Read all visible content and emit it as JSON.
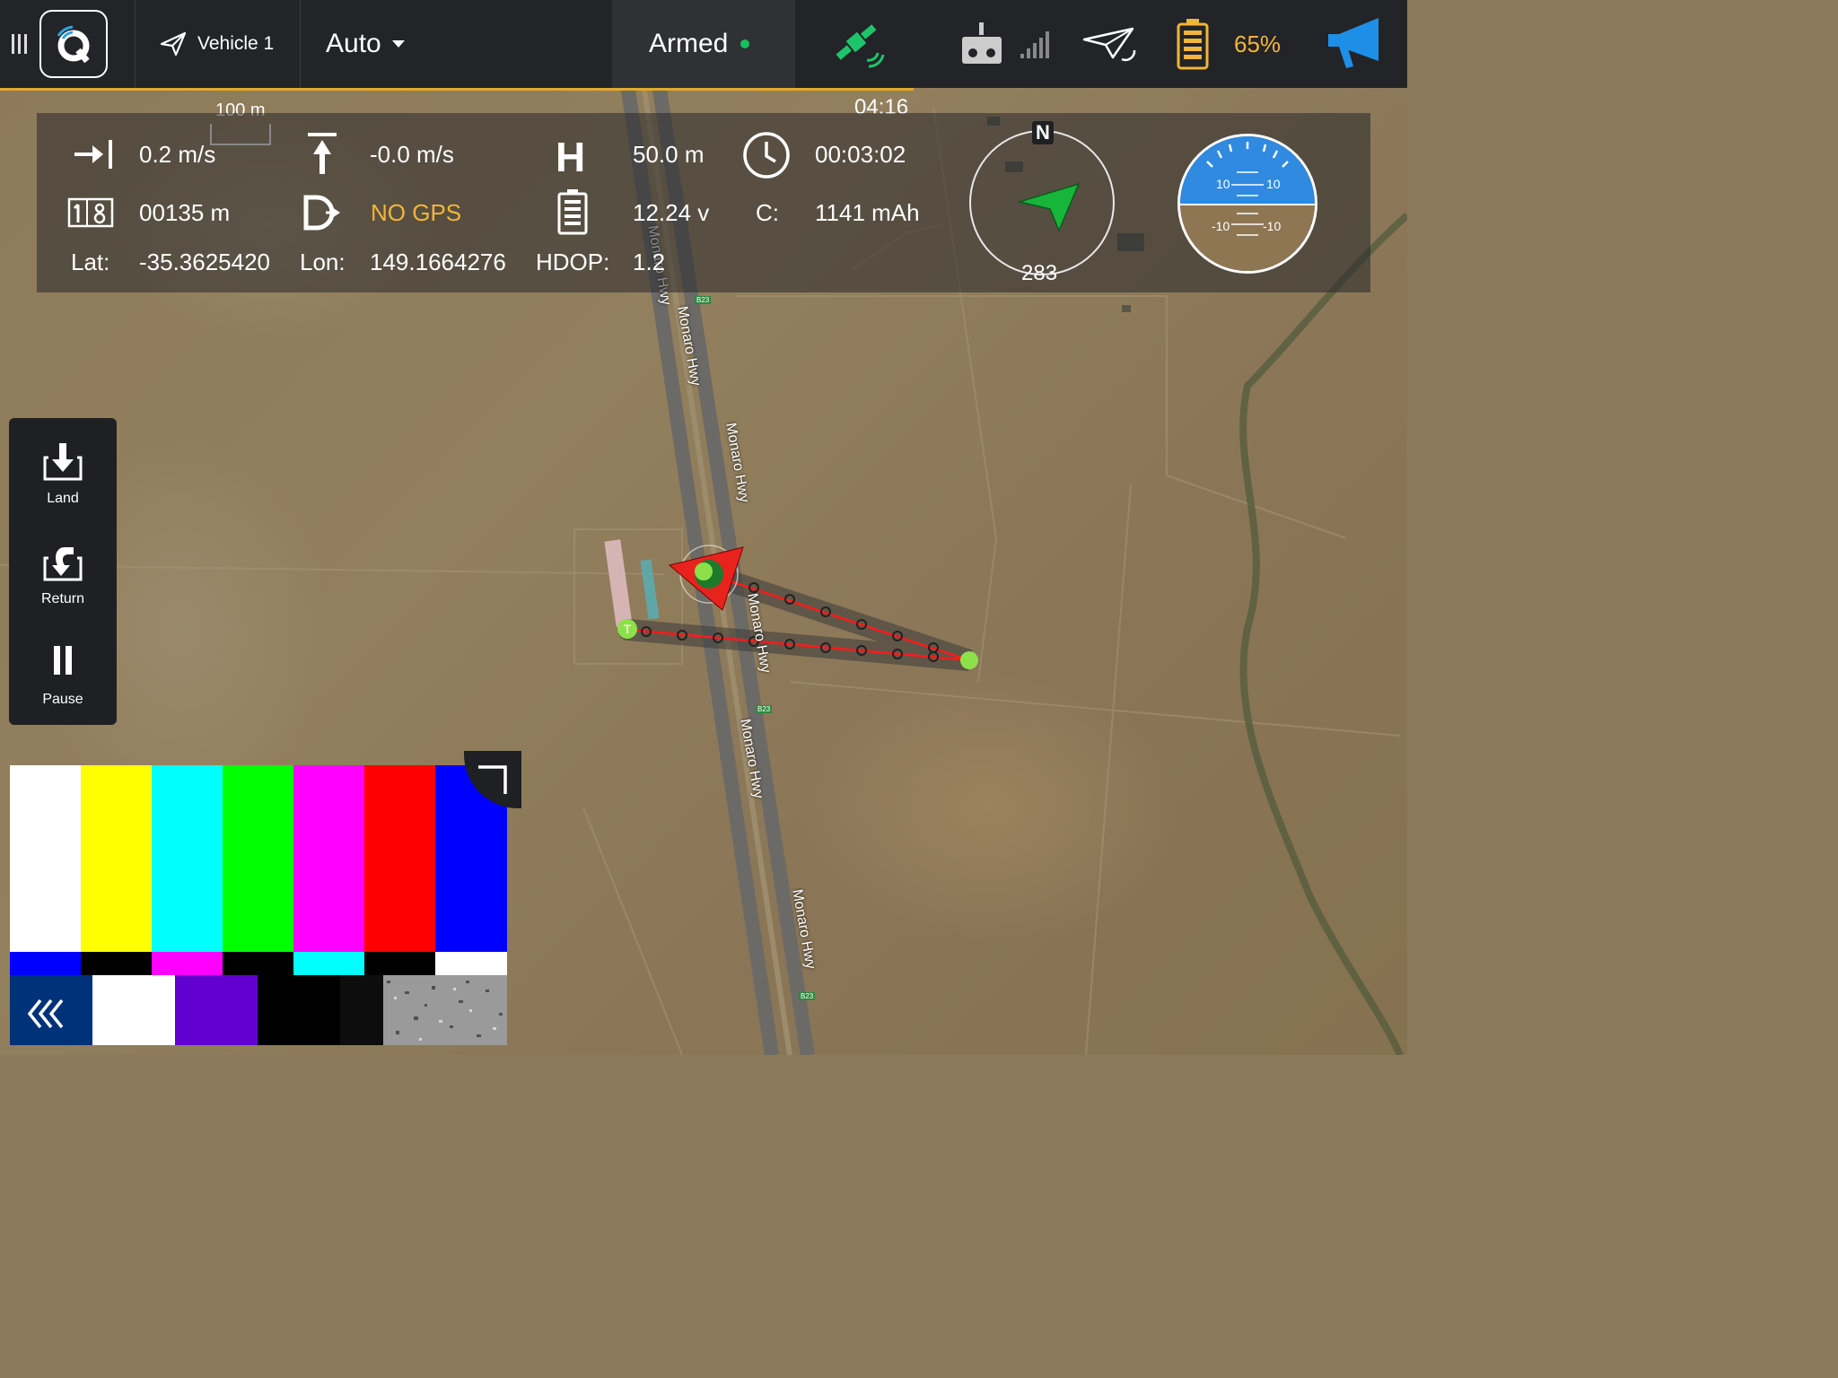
{
  "topbar": {
    "vehicle": "Vehicle 1",
    "mode": "Auto",
    "armed": "Armed",
    "battery_pct": "65%",
    "colors": {
      "armed_dot": "#18c05a",
      "battery": "#f1b53a",
      "gps": "#1ec46a",
      "megaphone": "#1e8fe6"
    },
    "icons": [
      "menu-icon",
      "qgc-logo-icon",
      "paper-plane-icon",
      "chevron-down-icon",
      "gps-satellite-icon",
      "rc-remote-icon",
      "signal-bars-icon",
      "telemetry-plane-icon",
      "battery-icon",
      "megaphone-icon"
    ]
  },
  "map": {
    "scale_label": "100 m",
    "mission_time": "04:16",
    "compass_north": "N",
    "heading": "283",
    "roads": [
      "Monaro Hwy",
      "Monaro Hwy",
      "Monaro Hwy",
      "Monaro Hwy",
      "Monaro Hwy",
      "Monaro Hwy"
    ],
    "route_shields": [
      "B23",
      "B23",
      "B23"
    ],
    "takeoff_marker": "T"
  },
  "telemetry": {
    "ground_speed": "0.2 m/s",
    "climb_rate": "-0.0 m/s",
    "alt_label": "H",
    "altitude": "50.0 m",
    "flight_time": "00:03:02",
    "odometer": "00135 m",
    "gps_status": "NO GPS",
    "voltage": "12.24 v",
    "current_label": "C:",
    "consumed": "1141 mAh",
    "lat_label": "Lat:",
    "lat": "-35.3625420",
    "lon_label": "Lon:",
    "lon": "149.1664276",
    "hdop_label": "HDOP:",
    "hdop": "1.2"
  },
  "attitude": {
    "pitch_top_left": "10",
    "pitch_top_right": "10",
    "pitch_bottom_left": "-10",
    "pitch_bottom_right": "-10"
  },
  "actions": [
    {
      "label": "Land",
      "icon": "land-icon"
    },
    {
      "label": "Return",
      "icon": "return-icon"
    },
    {
      "label": "Pause",
      "icon": "pause-icon"
    }
  ]
}
